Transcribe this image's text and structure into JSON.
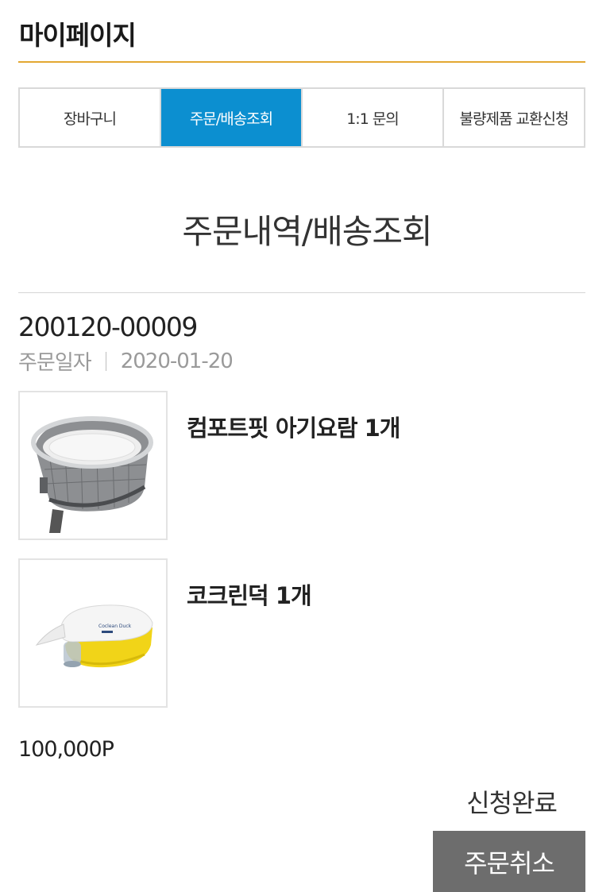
{
  "header": {
    "title": "마이페이지",
    "accent_color": "#e3a832"
  },
  "tabs": [
    {
      "label": "장바구니",
      "active": false
    },
    {
      "label": "주문/배송조회",
      "active": true
    },
    {
      "label": "1:1 문의",
      "active": false
    },
    {
      "label": "불량제품 교환신청",
      "active": false
    }
  ],
  "tab_active_color": "#0c8fd0",
  "section": {
    "title": "주문내역/배송조회"
  },
  "order": {
    "number": "200120-00009",
    "date_label": "주문일자",
    "date": "2020-01-20",
    "items": [
      {
        "name": "컴포트핏 아기요람 1개",
        "icon": "baby-bassinet-image"
      },
      {
        "name": "코크린덕 1개",
        "icon": "nasal-aspirator-image",
        "product_text": "Coclean Duck"
      }
    ],
    "total_points": "100,000P",
    "status": "신청완료",
    "cancel_label": "주문취소"
  }
}
